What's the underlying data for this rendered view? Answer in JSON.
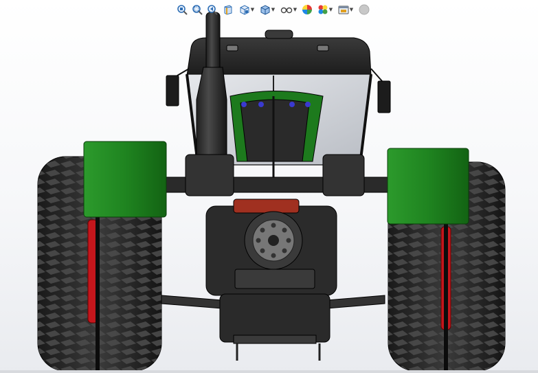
{
  "window": {
    "title": ""
  },
  "viewport": {
    "description_name": "tractor-assembly-3d-view"
  },
  "heads_up_toolbar": {
    "items": [
      {
        "id": "zoom-to-fit",
        "icon": "zoom-to-fit-icon",
        "has_dropdown": false
      },
      {
        "id": "zoom-to-area",
        "icon": "zoom-to-area-icon",
        "has_dropdown": false
      },
      {
        "id": "previous-view",
        "icon": "previous-view-icon",
        "has_dropdown": false
      },
      {
        "id": "section-view",
        "icon": "section-view-icon",
        "has_dropdown": false
      },
      {
        "id": "view-orientation",
        "icon": "view-orientation-icon",
        "has_dropdown": true
      },
      {
        "id": "display-style",
        "icon": "display-style-icon",
        "has_dropdown": true
      },
      {
        "id": "hide-show-items",
        "icon": "hide-show-items-icon",
        "has_dropdown": true
      },
      {
        "id": "edit-appearance",
        "icon": "edit-appearance-icon",
        "has_dropdown": false
      },
      {
        "id": "apply-scene",
        "icon": "apply-scene-icon",
        "has_dropdown": true
      },
      {
        "id": "view-settings",
        "icon": "view-settings-icon",
        "has_dropdown": true
      },
      {
        "id": "realview",
        "icon": "realview-graphics-icon",
        "has_dropdown": false
      }
    ]
  },
  "colors": {
    "background_top": "#ffffff",
    "background_bottom": "#e9ebef",
    "body_dark": "#2b2b2b",
    "fender_green": "#1e7d1e",
    "wheel_red": "#c4161c",
    "toolbar_blue": "#2f6fb5"
  }
}
